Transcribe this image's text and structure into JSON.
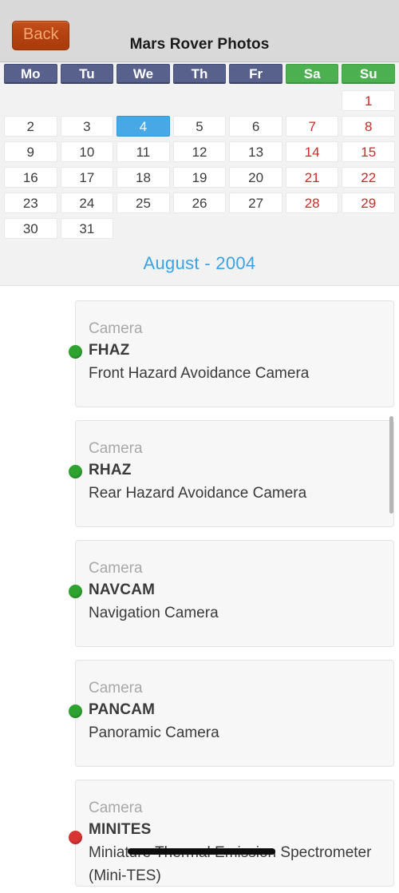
{
  "navbar": {
    "back_label": "Back",
    "title": "Mars Rover Photos"
  },
  "calendar": {
    "weekdays": [
      {
        "label": "Mo",
        "weekend": false
      },
      {
        "label": "Tu",
        "weekend": false
      },
      {
        "label": "We",
        "weekend": false
      },
      {
        "label": "Th",
        "weekend": false
      },
      {
        "label": "Fr",
        "weekend": false
      },
      {
        "label": "Sa",
        "weekend": true
      },
      {
        "label": "Su",
        "weekend": true
      }
    ],
    "weeks": [
      [
        "",
        "",
        "",
        "",
        "",
        "",
        "1"
      ],
      [
        "2",
        "3",
        "4",
        "5",
        "6",
        "7",
        "8"
      ],
      [
        "9",
        "10",
        "11",
        "12",
        "13",
        "14",
        "15"
      ],
      [
        "16",
        "17",
        "18",
        "19",
        "20",
        "21",
        "22"
      ],
      [
        "23",
        "24",
        "25",
        "26",
        "27",
        "28",
        "29"
      ],
      [
        "30",
        "31",
        "",
        "",
        "",
        "",
        ""
      ]
    ],
    "selected_day": "4",
    "month_label": "August - 2004",
    "colors": {
      "weekday_header": "#58618c",
      "weekend_header": "#4caf50",
      "weekend_text": "#c92a2a",
      "selected": "#47a8e5",
      "month_text": "#3aa3e3"
    }
  },
  "cameras": {
    "kicker": "Camera",
    "items": [
      {
        "code": "FHAZ",
        "description": "Front Hazard Avoidance Camera",
        "status": "available",
        "status_color": "#2fa32f"
      },
      {
        "code": "RHAZ",
        "description": "Rear Hazard Avoidance Camera",
        "status": "available",
        "status_color": "#2fa32f"
      },
      {
        "code": "NAVCAM",
        "description": "Navigation Camera",
        "status": "available",
        "status_color": "#2fa32f"
      },
      {
        "code": "PANCAM",
        "description": "Panoramic Camera",
        "status": "available",
        "status_color": "#2fa32f"
      },
      {
        "code": "MINITES",
        "description": "Miniature Thermal Emission Spectrometer (Mini-TES)",
        "status": "unavailable",
        "status_color": "#d83434"
      }
    ]
  }
}
